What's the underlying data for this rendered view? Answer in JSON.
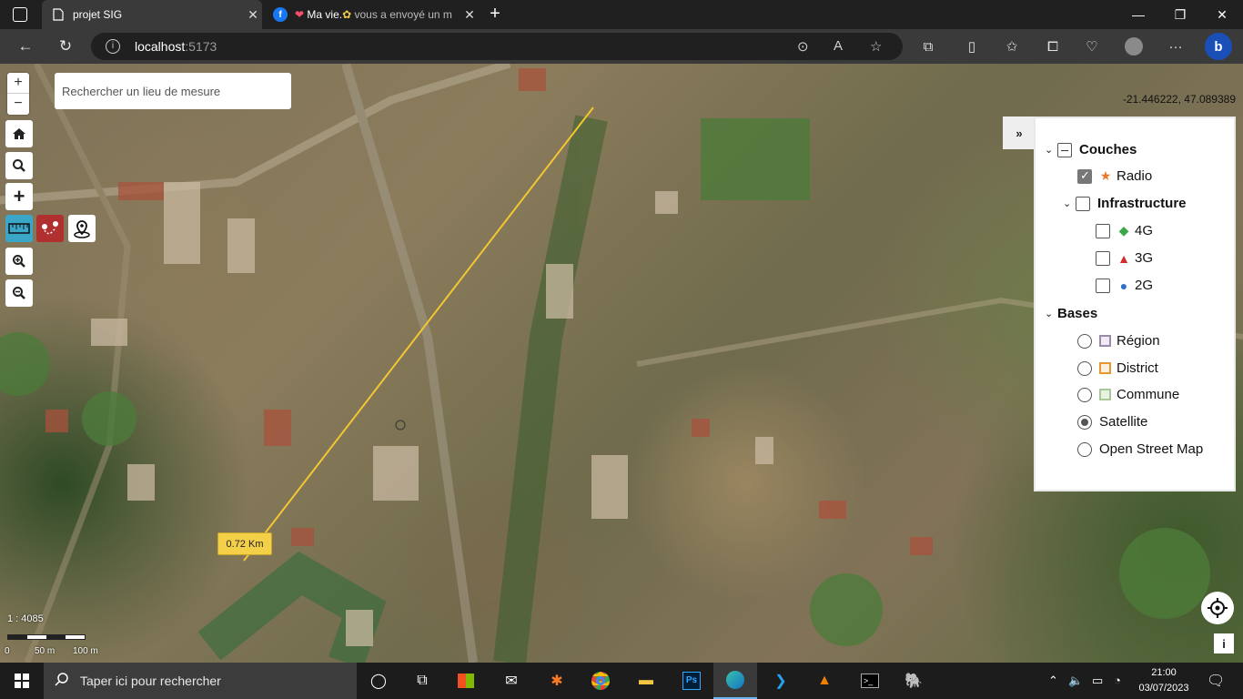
{
  "browser": {
    "tabs": [
      {
        "title": "projet SIG",
        "icon": "page-icon",
        "active": true
      },
      {
        "title": "Ma vie.",
        "title_suffix": "vous a envoyé un m",
        "icon": "facebook-icon",
        "active": false
      }
    ],
    "new_tab": "+",
    "address": {
      "host": "localhost",
      "port": ":5173"
    },
    "window_controls": {
      "minimize": "—",
      "maximize": "❐",
      "close": "✕"
    }
  },
  "map": {
    "search_placeholder": "Rechercher un lieu de mesure",
    "coordinates": "-21.446222, 47.089389",
    "zoom_in": "+",
    "zoom_out": "−",
    "measure_label": "0.72 Km",
    "scale": {
      "ratio": "1 : 4085",
      "ticks": [
        "0",
        "50 m",
        "100 m"
      ]
    },
    "collapse_label": "»",
    "info_label": "i"
  },
  "layers": {
    "couches_title": "Couches",
    "radio": {
      "label": "Radio",
      "checked": true,
      "color": "#e8772e"
    },
    "infrastructure": {
      "label": "Infrastructure",
      "checked": false
    },
    "children": [
      {
        "label": "4G",
        "color": "#3aa84a",
        "icon": "diamond-icon"
      },
      {
        "label": "3G",
        "color": "#d42a2a",
        "icon": "triangle-icon"
      },
      {
        "label": "2G",
        "color": "#2b72c9",
        "icon": "circle-icon"
      }
    ],
    "bases_title": "Bases",
    "bases": [
      {
        "label": "Région",
        "color": "#9b8aa8",
        "selected": false
      },
      {
        "label": "District",
        "color": "#e8962e",
        "selected": false
      },
      {
        "label": "Commune",
        "color": "#a8c89a",
        "selected": false
      },
      {
        "label": "Satellite",
        "selected": true
      },
      {
        "label": "Open Street Map",
        "selected": false
      }
    ]
  },
  "taskbar": {
    "search_text": "Taper ici pour rechercher",
    "time": "21:00",
    "date": "03/07/2023"
  }
}
